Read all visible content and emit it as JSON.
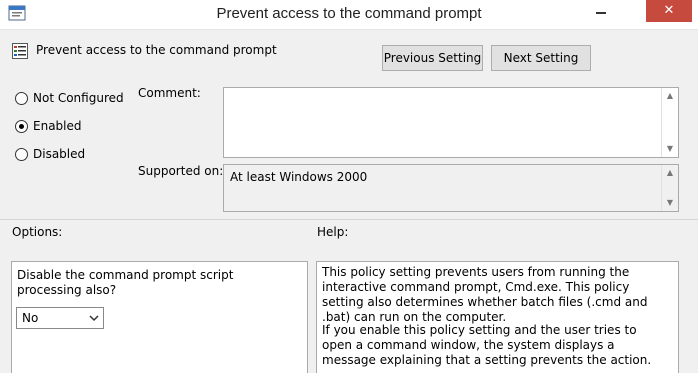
{
  "window": {
    "title": "Prevent access to the command prompt",
    "close_glyph": "✕",
    "colors": {
      "close_button": "#c74a3f",
      "dialog_bg": "#f0f0f0"
    }
  },
  "header": {
    "policy_name": "Prevent access to the command prompt",
    "previous_label": "Previous Setting",
    "next_label": "Next Setting"
  },
  "state_options": [
    {
      "label": "Not Configured",
      "selected": false
    },
    {
      "label": "Enabled",
      "selected": true
    },
    {
      "label": "Disabled",
      "selected": false
    }
  ],
  "comment": {
    "label": "Comment:",
    "value": ""
  },
  "supported": {
    "label": "Supported on:",
    "value": "At least Windows 2000"
  },
  "options": {
    "label": "Options:",
    "question": "Disable the command prompt script processing also?",
    "select_value": "No"
  },
  "help": {
    "label": "Help:",
    "paragraph1": "This policy setting prevents users from running the interactive command prompt, Cmd.exe.  This policy setting also determines whether batch files (.cmd and .bat) can run on the computer.",
    "paragraph2": "If you enable this policy setting and the user tries to open a command window, the system displays a message explaining that a setting prevents the action."
  }
}
